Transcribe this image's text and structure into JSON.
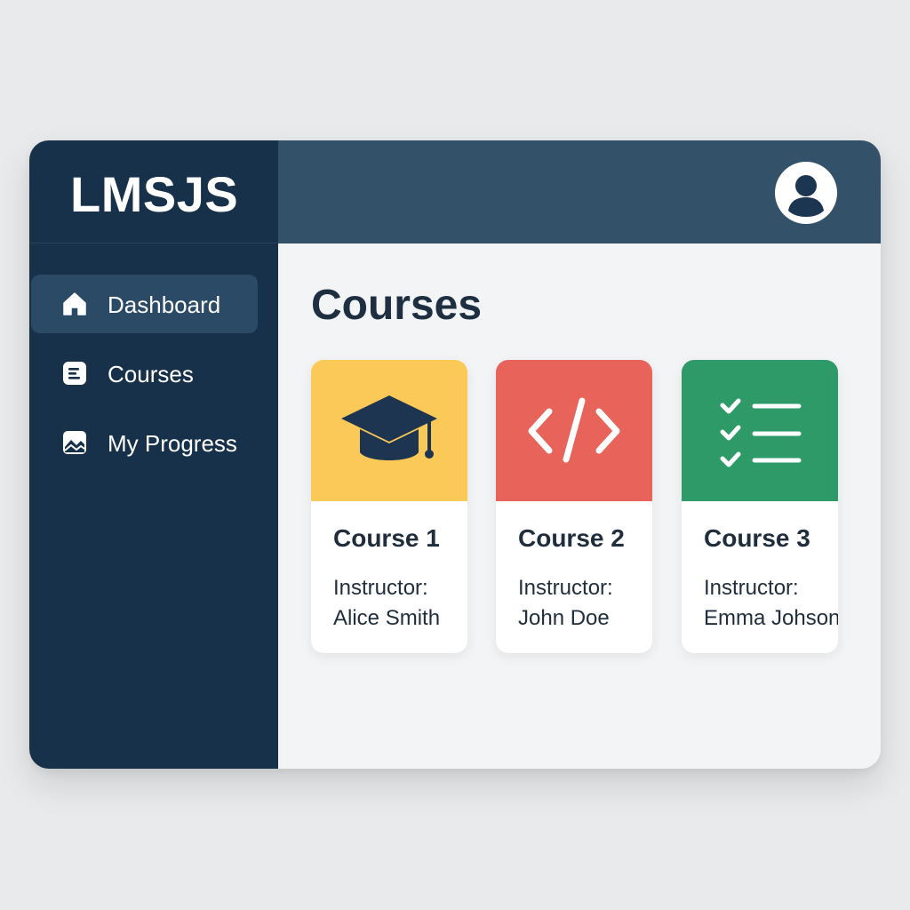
{
  "app": {
    "brand": "LMSJS"
  },
  "sidebar": {
    "items": [
      {
        "label": "Dashboard",
        "icon": "home-icon",
        "active": true
      },
      {
        "label": "Courses",
        "icon": "document-icon",
        "active": false
      },
      {
        "label": "My Progress",
        "icon": "chart-icon",
        "active": false
      }
    ]
  },
  "header": {
    "avatar_icon": "user-avatar-icon"
  },
  "main": {
    "title": "Courses",
    "courses": [
      {
        "title": "Course 1",
        "instructor_label": "Instructor:",
        "instructor": "Alice Smith",
        "color": "#fbc958",
        "icon": "graduation-cap-icon"
      },
      {
        "title": "Course 2",
        "instructor_label": "Instructor:",
        "instructor": "John Doe",
        "color": "#e8635a",
        "icon": "code-icon"
      },
      {
        "title": "Course 3",
        "instructor_label": "Instructor:",
        "instructor": "Emma Johson",
        "color": "#2e9a67",
        "icon": "checklist-icon"
      }
    ]
  },
  "colors": {
    "sidebar": "#18314a",
    "topbar": "#335169",
    "active_item": "#2b4a66",
    "content_bg": "#f3f4f5",
    "text_dark": "#1e2f42"
  }
}
